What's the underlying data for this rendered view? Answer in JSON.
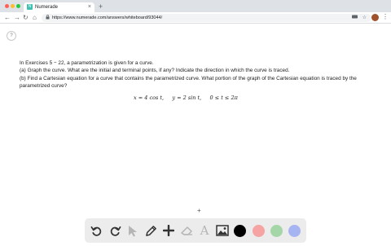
{
  "browser": {
    "tab": {
      "favicon": "N",
      "title": "Numerade",
      "close": "×"
    },
    "new_tab": "+",
    "nav": {
      "back": "←",
      "forward": "→",
      "reload": "↻",
      "home": "⌂"
    },
    "url": "https://www.numerade.com/answers/whiteboard/93044/",
    "icons": {
      "lock": "🔒",
      "key": "▬",
      "star": "☆",
      "menu": "⋮"
    }
  },
  "page": {
    "help": "?",
    "problem_lines": [
      "In Exercises 5 − 22, a parametrization is given for a curve.",
      "(a) Graph the curve. What are the initial and terminal points, if any? Indicate the direction in which the curve is traced.",
      "(b) Find a Cartesian equation for a curve that contains the parametrized curve. What portion of the graph of the Cartesian equation is traced by the parametrized curve?"
    ],
    "equation": "x = 4 cos t,     y = 2 sin t,     0 ≤ t ≤ 2π",
    "cursor": "+"
  },
  "whiteboard": {
    "tools": {
      "undo": "↶",
      "redo": "↷",
      "select": "➤",
      "pen": "✎",
      "add": "✚",
      "eraser": "⌫",
      "text": "A",
      "image": "🖼"
    },
    "colors": [
      "#000000",
      "#f5a3a3",
      "#a5d6a7",
      "#a7b4f2"
    ]
  }
}
